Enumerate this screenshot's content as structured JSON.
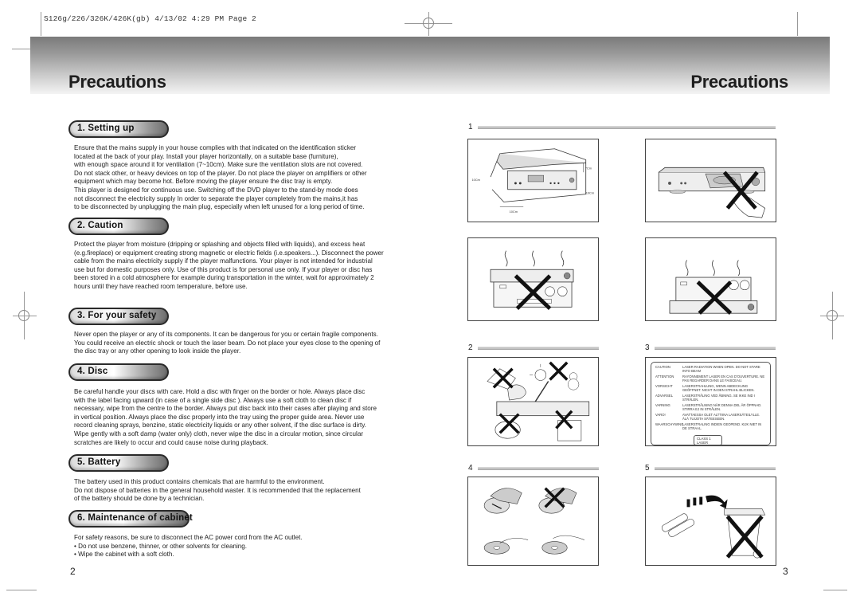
{
  "slug": "S126g/226/326K/426K(gb)  4/13/02 4:29 PM  Page 2",
  "pages": {
    "left_title": "Precautions",
    "right_title": "Precautions",
    "left_folio": "2",
    "right_folio": "3"
  },
  "sections": [
    {
      "title": "1. Setting up",
      "lines": [
        "Ensure that the mains supply in your house complies with that indicated on the identification sticker",
        "located at the back of your play. Install  your player horizontally, on a suitable base (furniture),",
        "with enough space around it for ventilation (7~10cm). Make sure the ventilation slots are not covered.",
        "Do not stack other, or heavy devices on top of the player. Do not place the player on amplifiers or other",
        "equipment which may become hot. Before moving the player ensure the disc tray is empty.",
        "This player is designed for continuous use. Switching off the DVD player to the stand-by mode does",
        "not disconnect the electricity supply In order to separate the player completely from the mains,it has",
        "to be disconnected by unplugging the main plug, especially when left   unused for a long period of time."
      ]
    },
    {
      "title": "2. Caution",
      "lines": [
        "Protect the player from moisture (dripping or splashing and objects filled with liquids), and excess heat",
        "(e.g.fireplace) or equipment creating strong magnetic or electric fields (i.e.speakers...). Disconnect the power",
        "cable from the mains electricity supply if the player malfunctions. Your player is not intended for industrial",
        "use but  for domestic purposes only. Use of this product is for personal use only. If your player or disc has",
        "been stored in a cold atmosphere for example during transportation in the winter, wait for approximately 2",
        "hours until they have reached room temperature, before use."
      ]
    },
    {
      "title": "3. For your safety",
      "lines": [
        "Never open the player or any of its components. It can be dangerous for you or certain fragile components.",
        "You could receive an electric shock or touch the laser beam. Do not place your eyes close to the opening of",
        "the disc tray or any other opening to look inside the player."
      ]
    },
    {
      "title": "4. Disc",
      "lines": [
        "Be careful handle your discs with care. Hold a disc with finger on the border or hole. Always place disc",
        "with the label facing upward (in case of a single side disc ). Always use a soft cloth to clean disc if",
        "necessary, wipe from the centre to the border. Always put disc back into their cases after playing and store",
        "in vertical position. Always place the disc properly into the tray using the proper guide area. Never use",
        "record cleaning sprays, benzine, static electricity liquids or any other solvent, if the disc surface is dirty.",
        "Wipe gently with a soft damp (water only) cloth, never wipe the disc in a circular motion, since circular",
        "scratches are likely to occur and could cause noise during playback."
      ]
    },
    {
      "title": "5. Battery",
      "lines": [
        "The battery used in this product contains chemicals that are harmful to the environment.",
        "Do not dispose of batteries in the general household waster. It is recommended that the replacement",
        "of the battery should be done by a technician."
      ]
    },
    {
      "title": "6. Maintenance of cabinet",
      "lines": [
        "For safety reasons, be sure to disconnect the AC power cord from the AC outlet."
      ],
      "bullets": [
        "Do not use benzene, thinner, or other solvents for cleaning.",
        "Wipe the cabinet with a soft cloth."
      ]
    }
  ],
  "figures": {
    "numbers": [
      "1",
      "2",
      "3",
      "4",
      "5"
    ],
    "dimension_labels": {
      "top": "7Cm",
      "side": "10Cm",
      "right": "10Cm",
      "front": "10Cm"
    },
    "laser_label": [
      {
        "lang": "CAUTION",
        "msg": "LASER RADIATION WHEN OPEN. DO NOT STARE INTO BEAM"
      },
      {
        "lang": "ATTENTION",
        "msg": "RAYONNEMENT LASER EN CAS D'OUVERTURE. NE PAS REGARDER DANS LE FAISCEAU."
      },
      {
        "lang": "VORSICHT",
        "msg": "LASERSTRAHLUNG, WENN ABDECKUNG GEÖFFNET. NICHT IN DEN STRAHL BLICKEN."
      },
      {
        "lang": "ADVARSEL",
        "msg": "LASERSTRÅLING VED ÅBNING. SE IKKE IND I STRÅLEN."
      },
      {
        "lang": "VARNING",
        "msg": "LASERSTRÅLNING NÄR DENNA DEL ÄR ÖPPNAD. STIRRA EJ IN STRÅLEN."
      },
      {
        "lang": "VARO!",
        "msg": "AVATTAESSA OLET ALTTIINA LASERSÄTEILYLLE. ÄLÄ TUIJOTA SÄTEESEEN."
      },
      {
        "lang": "WAARSCHYWING",
        "msg": "LASERSTRALING INDIEN GEOPEND. KIJK NIET IN DE STRAAL."
      }
    ],
    "laser_class": [
      "CLASS 1",
      "LASER PRODUCT"
    ]
  }
}
